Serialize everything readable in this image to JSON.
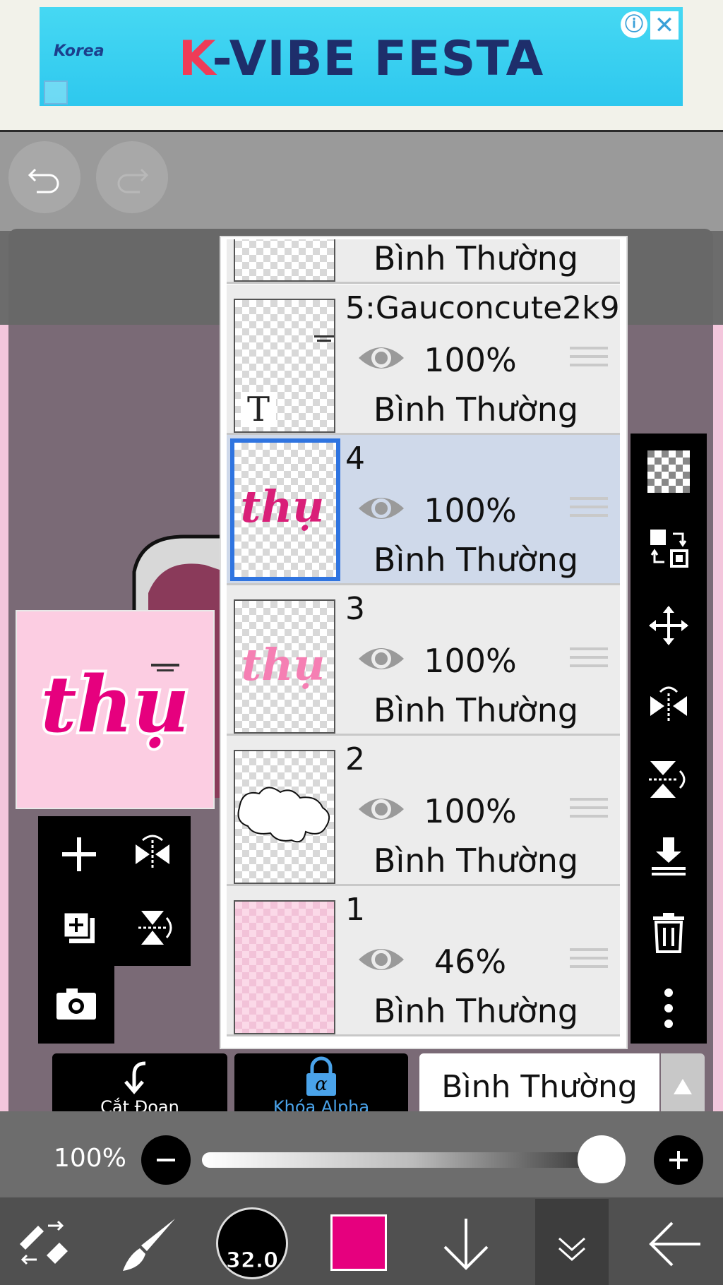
{
  "ad": {
    "title_k": "K",
    "title_rest": "-VIBE FESTA",
    "logo_text": "Korea",
    "info": "ⓘ",
    "close": "✕"
  },
  "layers": {
    "top_partial_mode": "Bình Thường",
    "items": [
      {
        "name": "5:Gauconcute2k9",
        "opacity": "100%",
        "mode": "Bình Thường",
        "selected": false,
        "thumb": "text",
        "thumb_glyph": "T"
      },
      {
        "name": "4",
        "opacity": "100%",
        "mode": "Bình Thường",
        "selected": true,
        "thumb": "thu-dark"
      },
      {
        "name": "3",
        "opacity": "100%",
        "mode": "Bình Thường",
        "selected": false,
        "thumb": "thu-light"
      },
      {
        "name": "2",
        "opacity": "100%",
        "mode": "Bình Thường",
        "selected": false,
        "thumb": "cloud"
      },
      {
        "name": "1",
        "opacity": "46%",
        "mode": "Bình Thường",
        "selected": false,
        "thumb": "pink"
      }
    ]
  },
  "buttons": {
    "cut_label": "Cắt Đoạn",
    "alpha_label": "Khóa Alpha",
    "blend_mode": "Bình Thường"
  },
  "slider": {
    "percent_label": "100%",
    "value": 1.0
  },
  "toolbar": {
    "brush_size": "32.0",
    "color": "#e6007e"
  },
  "preview": {
    "text": "thụ"
  }
}
